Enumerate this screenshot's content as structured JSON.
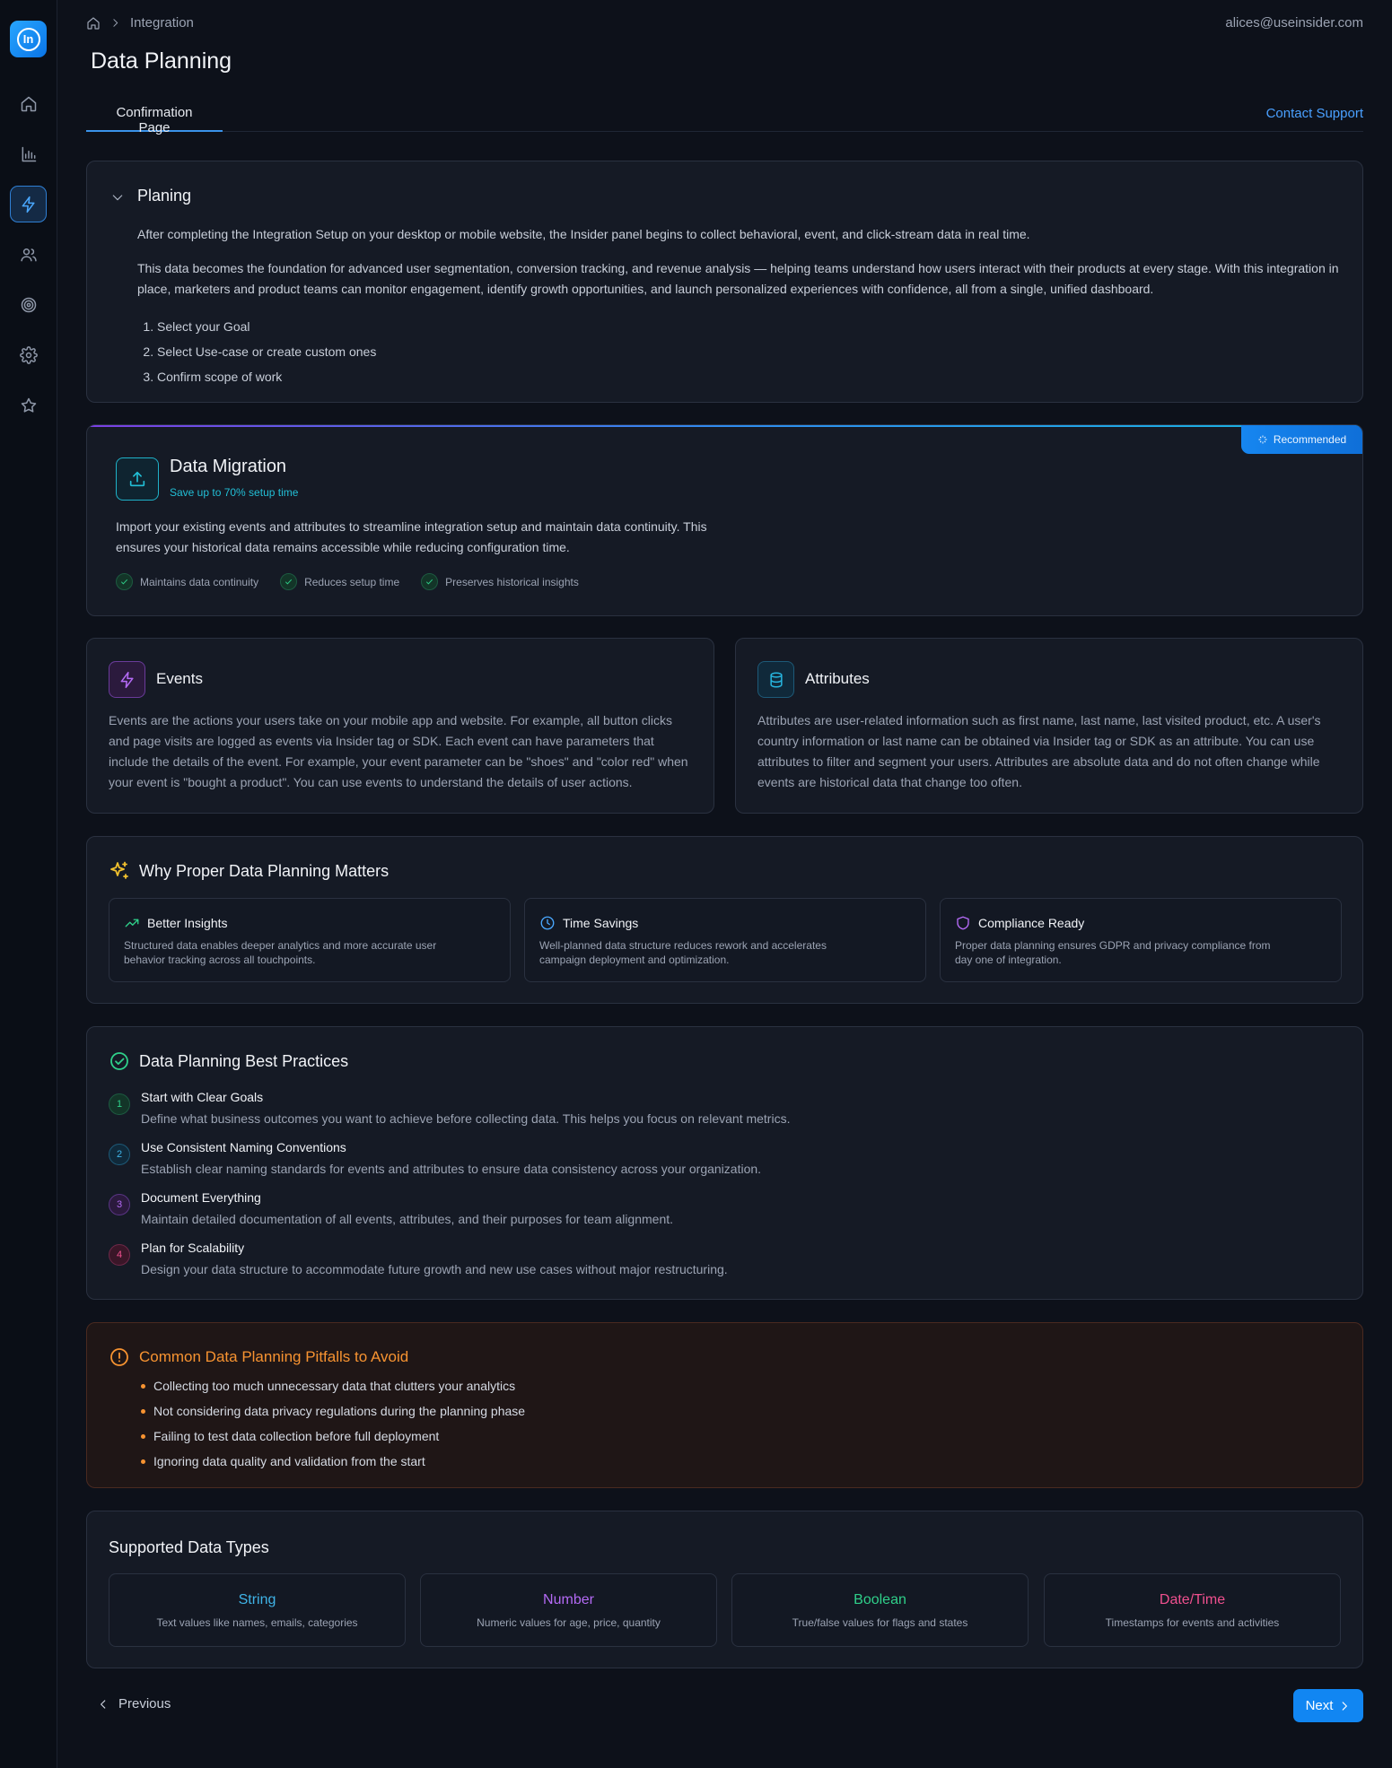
{
  "sidebar": {
    "logo_text": "In",
    "items": [
      {
        "icon": "home-icon"
      },
      {
        "icon": "bar-chart-icon"
      },
      {
        "icon": "lightning-icon",
        "active": true
      },
      {
        "icon": "users-icon"
      },
      {
        "icon": "target-icon"
      },
      {
        "icon": "gear-icon"
      },
      {
        "icon": "star-icon"
      }
    ]
  },
  "header": {
    "breadcrumb": "Integration",
    "user_email": "alices@useinsider.com",
    "title": "Data Planning",
    "tab": "Confirmation Page",
    "contact": "Contact Support"
  },
  "planing": {
    "title": "Planing",
    "p1": "After completing the Integration Setup on your desktop or mobile website, the Insider panel begins to collect behavioral, event, and click-stream data in real time.",
    "p2": "This data becomes the foundation for advanced user segmentation, conversion tracking, and revenue analysis — helping teams understand how users interact with their products at every stage. With this integration in place, marketers and product teams can monitor engagement, identify growth opportunities, and launch personalized experiences with confidence, all from a single, unified dashboard.",
    "steps": [
      "Select your Goal",
      "Select Use-case or create custom ones",
      "Confirm scope of work"
    ]
  },
  "migration": {
    "badge": "Recommended",
    "title": "Data Migration",
    "subtitle": "Save up to 70% setup time",
    "description": "Import your existing events and attributes to streamline integration setup and maintain data continuity. This ensures your historical data remains accessible while reducing configuration time.",
    "features": [
      "Maintains data continuity",
      "Reduces setup time",
      "Preserves historical insights"
    ]
  },
  "events": {
    "title": "Events",
    "description": "Events are the actions your users take on your mobile app and website. For example, all button clicks and page visits are logged as events via Insider tag or SDK. Each event can have parameters that include the details of the event. For example, your event parameter can be \"shoes\" and \"color red\" when your event is \"bought a product\". You can use events to understand the details of user actions."
  },
  "attributes": {
    "title": "Attributes",
    "description": "Attributes are user-related information such as first name, last name, last visited product, etc. A user's country information or last name can be obtained via Insider tag or SDK as an attribute. You can use attributes to filter and segment your users. Attributes are absolute data and do not often change while events are historical data that change too often."
  },
  "why": {
    "title": "Why Proper Data Planning Matters",
    "items": [
      {
        "title": "Better Insights",
        "desc": "Structured data enables deeper analytics and more accurate user behavior tracking across all touchpoints.",
        "icon": "trending-up-icon",
        "color": "#2fd08a"
      },
      {
        "title": "Time Savings",
        "desc": "Well-planned data structure reduces rework and accelerates campaign deployment and optimization.",
        "icon": "clock-icon",
        "color": "#4aa8ff"
      },
      {
        "title": "Compliance Ready",
        "desc": "Proper data planning ensures GDPR and privacy compliance from day one of integration.",
        "icon": "shield-icon",
        "color": "#b46af5"
      }
    ]
  },
  "best_practices": {
    "title": "Data Planning Best Practices",
    "items": [
      {
        "num": "1",
        "title": "Start with Clear Goals",
        "desc": "Define what business outcomes you want to achieve before collecting data. This helps you focus on relevant metrics.",
        "color": "#2fd08a",
        "bg": "#133528",
        "border": "#1d5a41"
      },
      {
        "num": "2",
        "title": "Use Consistent Naming Conventions",
        "desc": "Establish clear naming standards for events and attributes to ensure data consistency across your organization.",
        "color": "#3fb4e8",
        "bg": "#10293a",
        "border": "#1d5a78"
      },
      {
        "num": "3",
        "title": "Document Everything",
        "desc": "Maintain detailed documentation of all events, attributes, and their purposes for team alignment.",
        "color": "#b46af5",
        "bg": "#2b1a3d",
        "border": "#5a3585"
      },
      {
        "num": "4",
        "title": "Plan for Scalability",
        "desc": "Design your data structure to accommodate future growth and new use cases without major restructuring.",
        "color": "#f0508f",
        "bg": "#3a1628",
        "border": "#6e2848"
      }
    ]
  },
  "pitfalls": {
    "title": "Common Data Planning Pitfalls to Avoid",
    "items": [
      "Collecting too much unnecessary data that clutters your analytics",
      "Not considering data privacy regulations during the planning phase",
      "Failing to test data collection before full deployment",
      "Ignoring data quality and validation from the start"
    ]
  },
  "data_types": {
    "title": "Supported Data Types",
    "items": [
      {
        "name": "String",
        "desc": "Text values like names, emails, categories",
        "color": "#3fb4e8"
      },
      {
        "name": "Number",
        "desc": "Numeric values for age, price, quantity",
        "color": "#b46af5"
      },
      {
        "name": "Boolean",
        "desc": "True/false values for flags and states",
        "color": "#2fd08a"
      },
      {
        "name": "Date/Time",
        "desc": "Timestamps for events and activities",
        "color": "#f0508f"
      }
    ]
  },
  "footer": {
    "previous": "Previous",
    "next": "Next"
  }
}
